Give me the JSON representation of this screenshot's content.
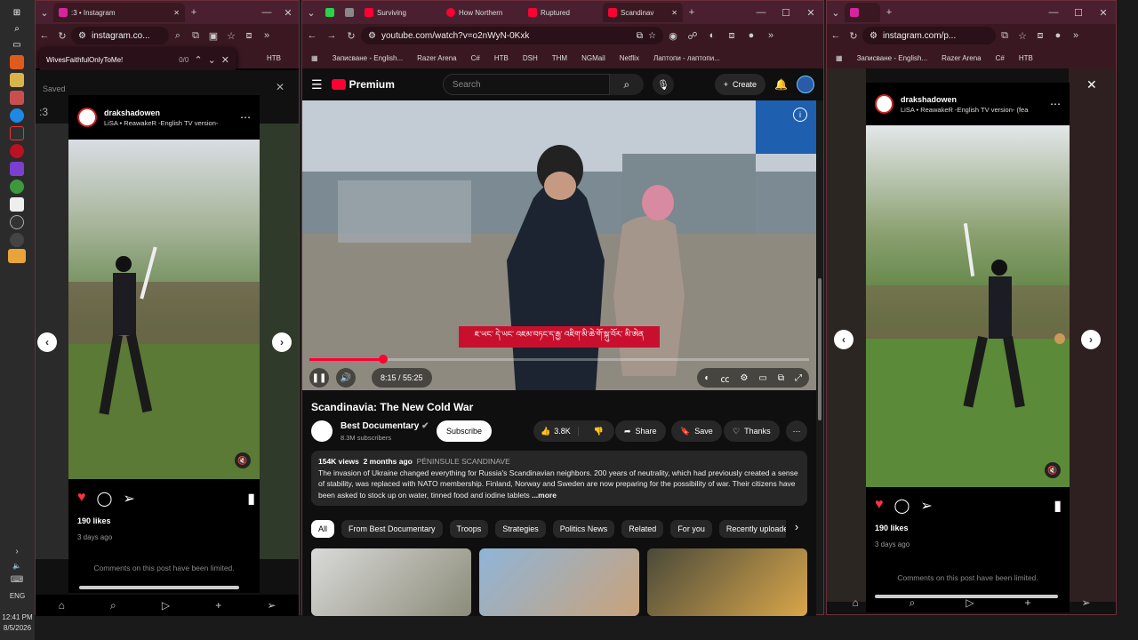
{
  "taskbar": {
    "time": "12:41 PM",
    "date": "8/5/2026",
    "lang": "ENG"
  },
  "left": {
    "tab_title": ":3 • Instagram",
    "url": "instagram.co...",
    "find_text": "WivesFaithfulOnlyToMe!",
    "find_count": "0/0",
    "bookmark": "НТВ",
    "saved": "Saved",
    "saved_count": ":3",
    "post_user": "drakshadowen",
    "post_audio": "LiSA • ReawakeR -English TV version-",
    "likes": "190 likes",
    "time_ago": "3 days ago",
    "comments_limited": "Comments on this post have been limited."
  },
  "middle": {
    "tabs": [
      "Surviving",
      "How Northern",
      "Ruptured",
      "Scandinav"
    ],
    "url": "youtube.com/watch?v=o2nWyN-0Kxk",
    "bookmarks": [
      "Записване - English...",
      "Razer Arena",
      "C#",
      "НТВ",
      "DSH",
      "THM",
      "NGMail",
      "Netflix",
      "Лаптопи - лаптопи..."
    ],
    "logo": "Premium",
    "search_placeholder": "Search",
    "create": "Create",
    "subtitle": "ཇ་ཡང་ དེ་ཡང་ འཇམ་བཏང་ད་རྒྱ་ འཇིག་མི་ཆེ་གོ་སྐུ་བོར་ མི་ཨེན",
    "time": "8:15 / 55:25",
    "progress": 0.148,
    "video_title": "Scandinavia: The New Cold War",
    "channel": "Best Documentary",
    "subscribers": "8.3M subscribers",
    "subscribe": "Subscribe",
    "likes": "3.8K",
    "share": "Share",
    "save": "Save",
    "thanks": "Thanks",
    "views": "154K views",
    "ago": "2 months ago",
    "hashtag": "PÉNINSULE SCANDINAVE",
    "description": "The invasion of Ukraine changed everything for Russia's Scandinavian neighbors. 200 years of neutrality, which had previously created a sense of stability, was replaced with NATO membership. Finland, Norway and Sweden are now preparing for the possibility of war. Their citizens have been asked to stock up on water, tinned food and iodine tablets",
    "more": "...more",
    "chips": [
      "All",
      "From Best Documentary",
      "Troops",
      "Strategies",
      "Politics News",
      "Related",
      "For you",
      "Recently uploaded"
    ]
  },
  "right": {
    "url": "instagram.com/p...",
    "bookmarks": [
      "Записване - English...",
      "Razer Arena",
      "C#",
      "НТВ"
    ],
    "post_user": "drakshadowen",
    "post_audio": "LiSA • ReawakeR -English TV version- (fea",
    "likes": "190 likes",
    "time_ago": "3 days ago",
    "comments_limited": "Comments on this post have been limited."
  },
  "colors": {
    "accent_red": "#ff0033",
    "browser_frame": "#4a2030",
    "like_red": "#ff3040"
  }
}
